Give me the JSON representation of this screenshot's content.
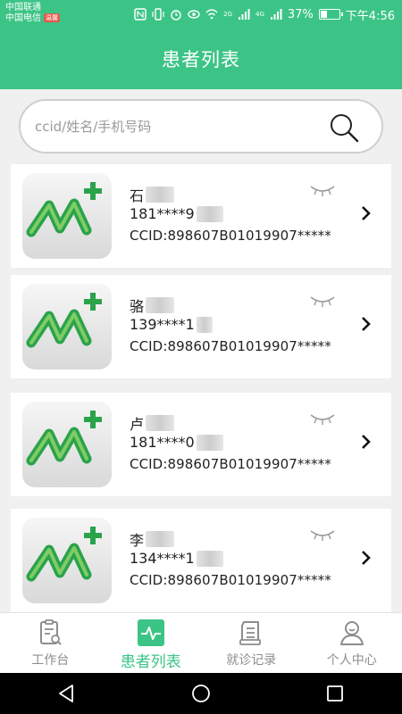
{
  "status_bar": {
    "carrier_1": "中国联通",
    "carrier_2": "中国电信",
    "carrier_badge": "温馨",
    "net_1": "2G",
    "net_2": "4G",
    "battery": "37%",
    "battery_level": 0.37,
    "time": "下午4:56"
  },
  "header": {
    "title": "患者列表"
  },
  "search": {
    "placeholder": "ccid/姓名/手机号码",
    "value": ""
  },
  "patients": [
    {
      "name": "石",
      "phone": "181****9",
      "ccid": "CCID:898607B01019907*****"
    },
    {
      "name": "骆",
      "phone": "139****1",
      "ccid": "CCID:898607B01019907*****"
    },
    {
      "name": "卢",
      "phone": "181****0",
      "ccid": "CCID:898607B01019907*****"
    },
    {
      "name": "李",
      "phone": "134****1",
      "ccid": "CCID:898607B01019907*****"
    }
  ],
  "nav": [
    {
      "label": "工作台",
      "icon": "clipboard-search-icon",
      "active": false
    },
    {
      "label": "患者列表",
      "icon": "pulse-icon",
      "active": true
    },
    {
      "label": "就诊记录",
      "icon": "document-list-icon",
      "active": false
    },
    {
      "label": "个人中心",
      "icon": "user-icon",
      "active": false
    }
  ],
  "colors": {
    "accent": "#3cc487",
    "muted": "#8d8d8d"
  }
}
